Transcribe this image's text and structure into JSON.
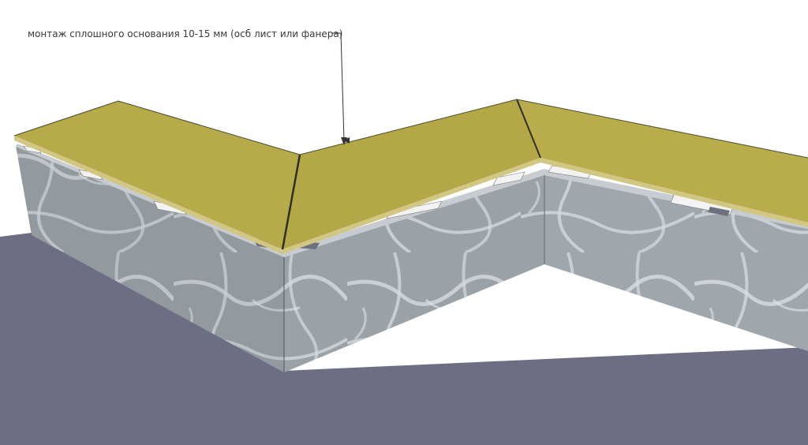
{
  "annotation": {
    "text": "монтаж сплошного основания 10-15 мм (осб лист или фанера)"
  },
  "colors": {
    "ground": "#6e6f85",
    "ground_edge": "#5d5e74",
    "wall_face": "#9da5ab",
    "wall_face_dark": "#8a9298",
    "wall_vein": "#d9dde0",
    "wall_top": "#c9cdd0",
    "sheathing_top": "#b5a94a",
    "sheathing_edge": "#cfc27a",
    "sheathing_seam": "#3c3c2a",
    "batten": "#f2f2f2",
    "batten_shadow": "#6e7080",
    "leader_line": "#333333"
  },
  "icons": [
    "arrow-down-icon"
  ]
}
